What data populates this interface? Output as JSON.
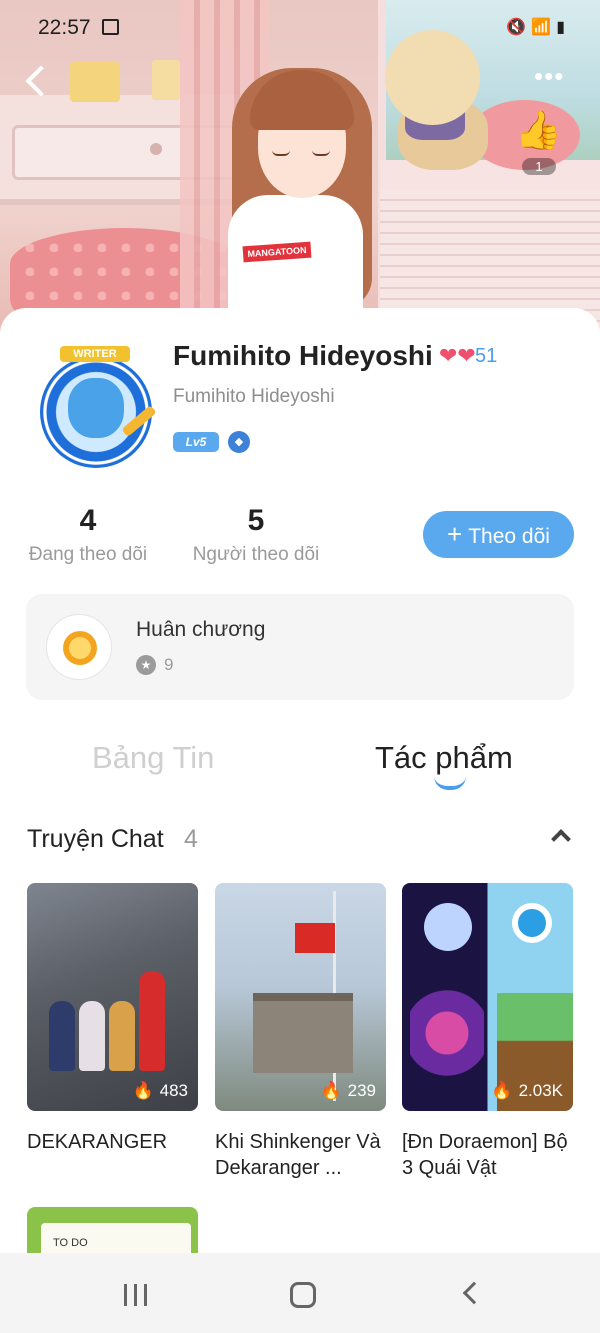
{
  "status_bar": {
    "time": "22:57",
    "icons": [
      "image-icon",
      "mute-icon",
      "wifi-icon",
      "signal-icon",
      "battery-icon"
    ]
  },
  "header": {
    "more_label": "•••",
    "like_count": "1",
    "shirt_logo": "MANGATOON"
  },
  "profile": {
    "avatar_banner": "WRITER",
    "name": "Fumihito Hideyoshi",
    "hearts_count": "51",
    "username": "Fumihito Hideyoshi",
    "level": "Lv5"
  },
  "stats": {
    "following_count": "4",
    "following_label": "Đang theo dõi",
    "followers_count": "5",
    "followers_label": "Người theo dõi"
  },
  "follow_button": {
    "plus": "+",
    "label": "Theo dõi"
  },
  "medals": {
    "title": "Huân chương",
    "count": "9"
  },
  "tabs": [
    {
      "label": "Bảng Tin",
      "active": false
    },
    {
      "label": "Tác phẩm",
      "active": true
    }
  ],
  "section": {
    "title": "Truyện Chat",
    "count": "4"
  },
  "stories": [
    {
      "title": "DEKARANGER",
      "views": "483"
    },
    {
      "title": "Khi Shinkenger Và Dekaranger ...",
      "views": "239"
    },
    {
      "title": "[Đn Doraemon] Bộ 3 Quái Vật",
      "views": "2.03K"
    },
    {
      "title": "",
      "views": "",
      "thumb_text": "TO DO"
    }
  ],
  "colors": {
    "accent": "#5aa9ee",
    "link": "#4b9df0",
    "heart": "#f0506e"
  }
}
